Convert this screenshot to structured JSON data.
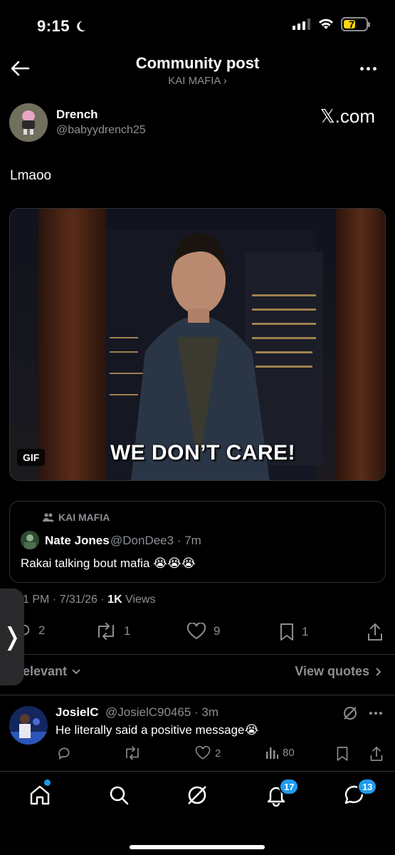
{
  "status": {
    "time": "9:15",
    "battery": "7"
  },
  "header": {
    "title": "Community post",
    "community": "KAI MAFIA ›"
  },
  "post": {
    "author_name": "Drench",
    "author_handle": "@babyydrench25",
    "site_label": "𝕏.com",
    "text": "Lmaoo",
    "gif_label": "GIF",
    "gif_caption": "WE DON’T CARE!"
  },
  "quote": {
    "community": "KAI MAFIA",
    "author_name": "Nate Jones",
    "author_handle": "@DonDee3 · 7m",
    "text": "Rakai talking bout mafia 😭😭😭"
  },
  "meta": {
    "time_date": "1 PM · 7/31/26 · ",
    "views_count": "1K",
    "views_label": " Views"
  },
  "actions": {
    "replies": "2",
    "reposts": "1",
    "likes": "9",
    "bookmarks": "1"
  },
  "sort": {
    "relevant": "elevant",
    "view_quotes": "View quotes"
  },
  "side_handle": "❭",
  "reply": {
    "author_name": "JosielC",
    "author_handle": "@JosielC90465 · 3m",
    "text": "He literally said a positive message😭",
    "likes": "2",
    "views": "80"
  },
  "tabbar": {
    "notifications_badge": "17",
    "messages_badge": "13"
  },
  "colors": {
    "accent": "#1d9bf0",
    "muted": "#8b8f94",
    "background": "#000000"
  }
}
